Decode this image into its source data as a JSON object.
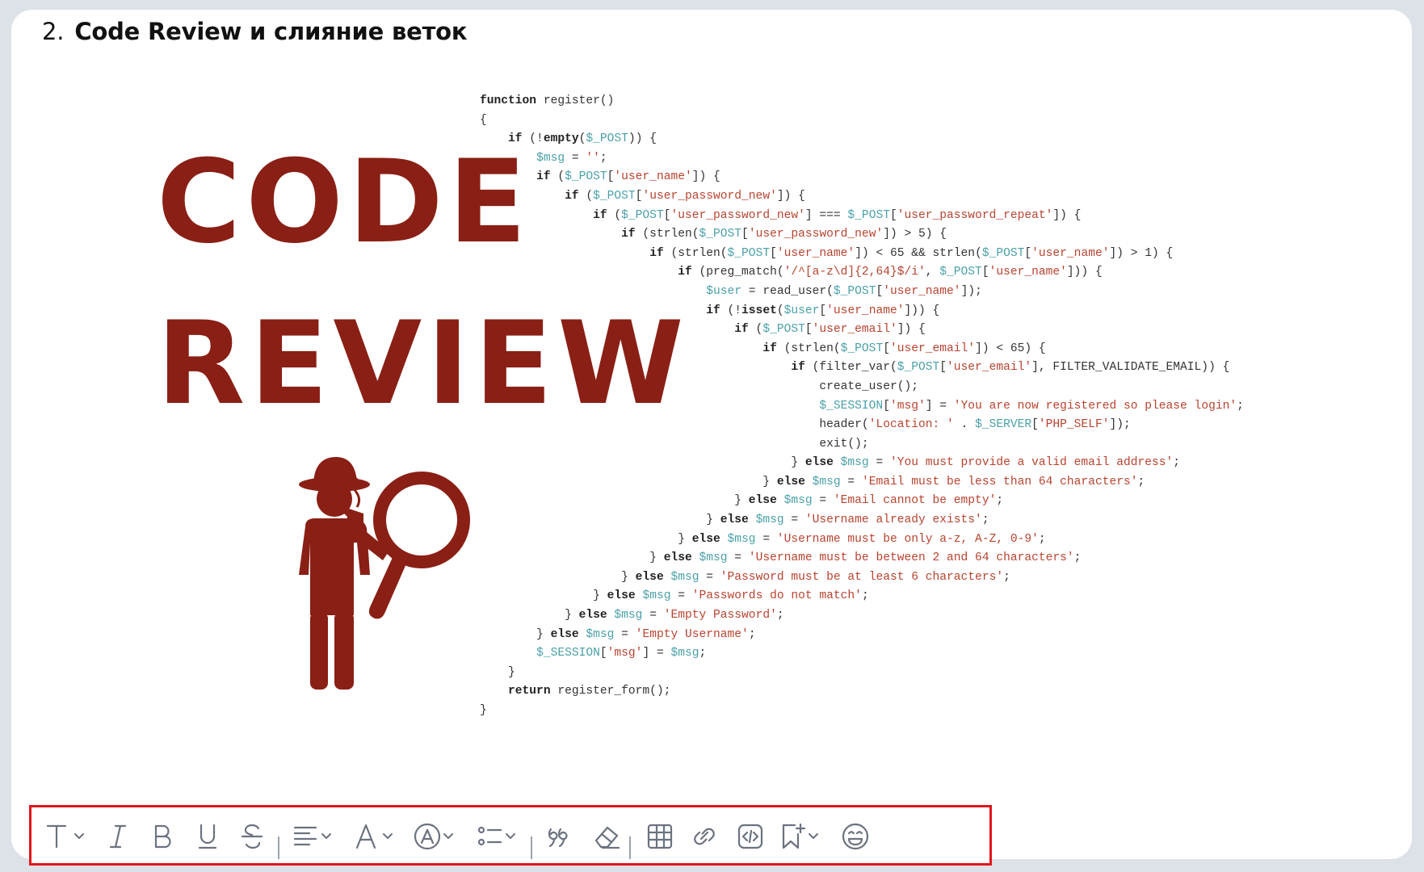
{
  "heading": {
    "number": "2.",
    "title": "Code Review и слияние веток"
  },
  "illustration": {
    "line1": "CODE",
    "line2": "REVIEW",
    "code_lines": [
      "function register()",
      "{",
      "    if (!empty($_POST)) {",
      "        $msg = '';",
      "        if ($_POST['user_name']) {",
      "            if ($_POST['user_password_new']) {",
      "                if ($_POST['user_password_new'] === $_POST['user_password_repeat']) {",
      "                    if (strlen($_POST['user_password_new']) > 5) {",
      "                        if (strlen($_POST['user_name']) < 65 && strlen($_POST['user_name']) > 1) {",
      "                            if (preg_match('/^[a-z\\d]{2,64}$/i', $_POST['user_name'])) {",
      "                                $user = read_user($_POST['user_name']);",
      "                                if (!isset($user['user_name'])) {",
      "                                    if ($_POST['user_email']) {",
      "                                        if (strlen($_POST['user_email']) < 65) {",
      "                                            if (filter_var($_POST['user_email'], FILTER_VALIDATE_EMAIL)) {",
      "                                                create_user();",
      "                                                $_SESSION['msg'] = 'You are now registered so please login';",
      "                                                header('Location: ' . $_SERVER['PHP_SELF']);",
      "                                                exit();",
      "                                            } else $msg = 'You must provide a valid email address';",
      "                                        } else $msg = 'Email must be less than 64 characters';",
      "                                    } else $msg = 'Email cannot be empty';",
      "                                } else $msg = 'Username already exists';",
      "                            } else $msg = 'Username must be only a-z, A-Z, 0-9';",
      "                        } else $msg = 'Username must be between 2 and 64 characters';",
      "                    } else $msg = 'Password must be at least 6 characters';",
      "                } else $msg = 'Passwords do not match';",
      "            } else $msg = 'Empty Password';",
      "        } else $msg = 'Empty Username';",
      "        $_SESSION['msg'] = $msg;",
      "    }",
      "    return register_form();",
      "}"
    ]
  },
  "colors": {
    "brand_red": "#8a1f15",
    "highlight_border": "#e4141c",
    "icon_gray": "#6b7280"
  },
  "toolbar": {
    "tools": [
      {
        "name": "text-style-icon",
        "dropdown": true
      },
      {
        "name": "italic-icon",
        "dropdown": false
      },
      {
        "name": "bold-icon",
        "dropdown": false
      },
      {
        "name": "underline-icon",
        "dropdown": false
      },
      {
        "name": "strikethrough-icon",
        "dropdown": false
      },
      {
        "name": "align-icon",
        "dropdown": true
      },
      {
        "name": "font-color-icon",
        "dropdown": true
      },
      {
        "name": "highlight-color-icon",
        "dropdown": true
      },
      {
        "name": "list-icon",
        "dropdown": true
      },
      {
        "name": "quote-icon",
        "dropdown": false
      },
      {
        "name": "eraser-icon",
        "dropdown": false
      },
      {
        "name": "table-icon",
        "dropdown": false
      },
      {
        "name": "link-icon",
        "dropdown": false
      },
      {
        "name": "code-block-icon",
        "dropdown": false
      },
      {
        "name": "bookmark-add-icon",
        "dropdown": true
      },
      {
        "name": "emoji-icon",
        "dropdown": false
      }
    ]
  }
}
